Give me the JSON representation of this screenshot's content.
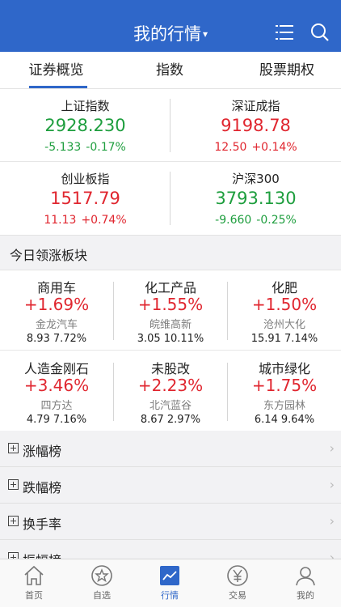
{
  "header": {
    "title": "我的行情",
    "caret": "▾",
    "menu_icon": "list-menu-icon",
    "search_icon": "search-icon",
    "color": "#2f67c9"
  },
  "tabs": [
    {
      "label": "证券概览",
      "active": true
    },
    {
      "label": "指数",
      "active": false
    },
    {
      "label": "股票期权",
      "active": false
    }
  ],
  "indices": [
    {
      "name": "上证指数",
      "price": "2928.230",
      "change": "-5.133",
      "percent": "-0.17%",
      "direction": "down"
    },
    {
      "name": "深证成指",
      "price": "9198.78",
      "change": "12.50",
      "percent": "+0.14%",
      "direction": "up"
    },
    {
      "name": "创业板指",
      "price": "1517.79",
      "change": "11.13",
      "percent": "+0.74%",
      "direction": "up"
    },
    {
      "name": "沪深300",
      "price": "3793.130",
      "change": "-9.660",
      "percent": "-0.25%",
      "direction": "down"
    }
  ],
  "section": {
    "title": "今日领涨板块"
  },
  "sectors": [
    {
      "name": "商用车",
      "percent": "+1.69%",
      "leader": "金龙汽车",
      "price": "8.93",
      "leader_pct": "7.72%"
    },
    {
      "name": "化工产品",
      "percent": "+1.55%",
      "leader": "皖维高新",
      "price": "3.05",
      "leader_pct": "10.11%"
    },
    {
      "name": "化肥",
      "percent": "+1.50%",
      "leader": "沧州大化",
      "price": "15.91",
      "leader_pct": "7.14%"
    },
    {
      "name": "人造金刚石",
      "percent": "+3.46%",
      "leader": "四方达",
      "price": "4.79",
      "leader_pct": "7.16%"
    },
    {
      "name": "未股改",
      "percent": "+2.23%",
      "leader": "北汽蓝谷",
      "price": "8.67",
      "leader_pct": "2.97%"
    },
    {
      "name": "城市绿化",
      "percent": "+1.75%",
      "leader": "东方园林",
      "price": "6.14",
      "leader_pct": "9.64%"
    }
  ],
  "lists": [
    {
      "label": "涨幅榜"
    },
    {
      "label": "跌幅榜"
    },
    {
      "label": "换手率"
    },
    {
      "label": "振幅榜"
    }
  ],
  "chevron": "›",
  "tabbar": [
    {
      "label": "首页",
      "icon": "home-icon",
      "active": false
    },
    {
      "label": "自选",
      "icon": "star-icon",
      "active": false
    },
    {
      "label": "行情",
      "icon": "chart-icon",
      "active": true
    },
    {
      "label": "交易",
      "icon": "yen-icon",
      "active": false
    },
    {
      "label": "我的",
      "icon": "user-icon",
      "active": false
    }
  ],
  "colors": {
    "up": "#e0262f",
    "down": "#1e9e3e",
    "accent": "#2f67c9"
  }
}
